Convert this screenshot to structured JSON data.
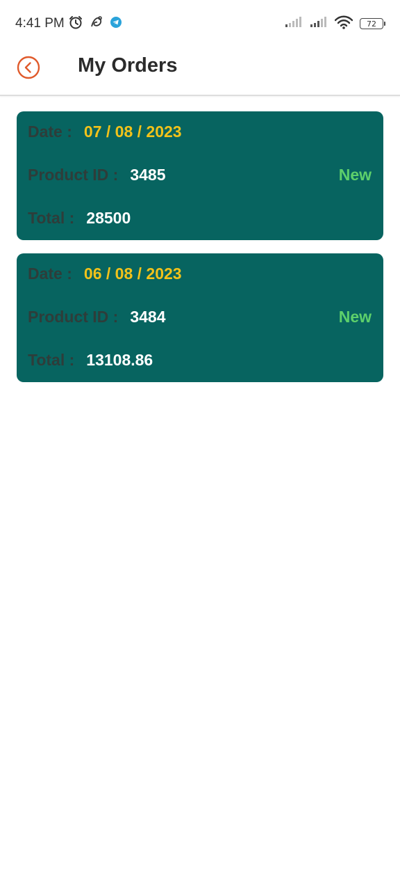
{
  "status_bar": {
    "time": "4:41 PM",
    "battery": "72",
    "icons_left": [
      "alarm-icon",
      "notification-app-icon",
      "telegram-icon"
    ],
    "icons_right": [
      "signal-1-icon",
      "signal-2-icon",
      "wifi-icon",
      "battery-icon"
    ]
  },
  "header": {
    "title": "My Orders",
    "back_icon": "back-arrow-icon",
    "accent_color": "#E05A2B"
  },
  "colors": {
    "card_bg": "#076460",
    "date_value": "#F2C21A",
    "status_new": "#5DD06B",
    "label": "#2E3D3A"
  },
  "orders": [
    {
      "date_label": "Date :",
      "date": "07 / 08 / 2023",
      "product_label": "Product ID :",
      "product_id": "3485",
      "status": "New",
      "total_label": "Total :",
      "total": "28500"
    },
    {
      "date_label": "Date :",
      "date": "06 / 08 / 2023",
      "product_label": "Product ID :",
      "product_id": "3484",
      "status": "New",
      "total_label": "Total :",
      "total": "13108.86"
    }
  ]
}
